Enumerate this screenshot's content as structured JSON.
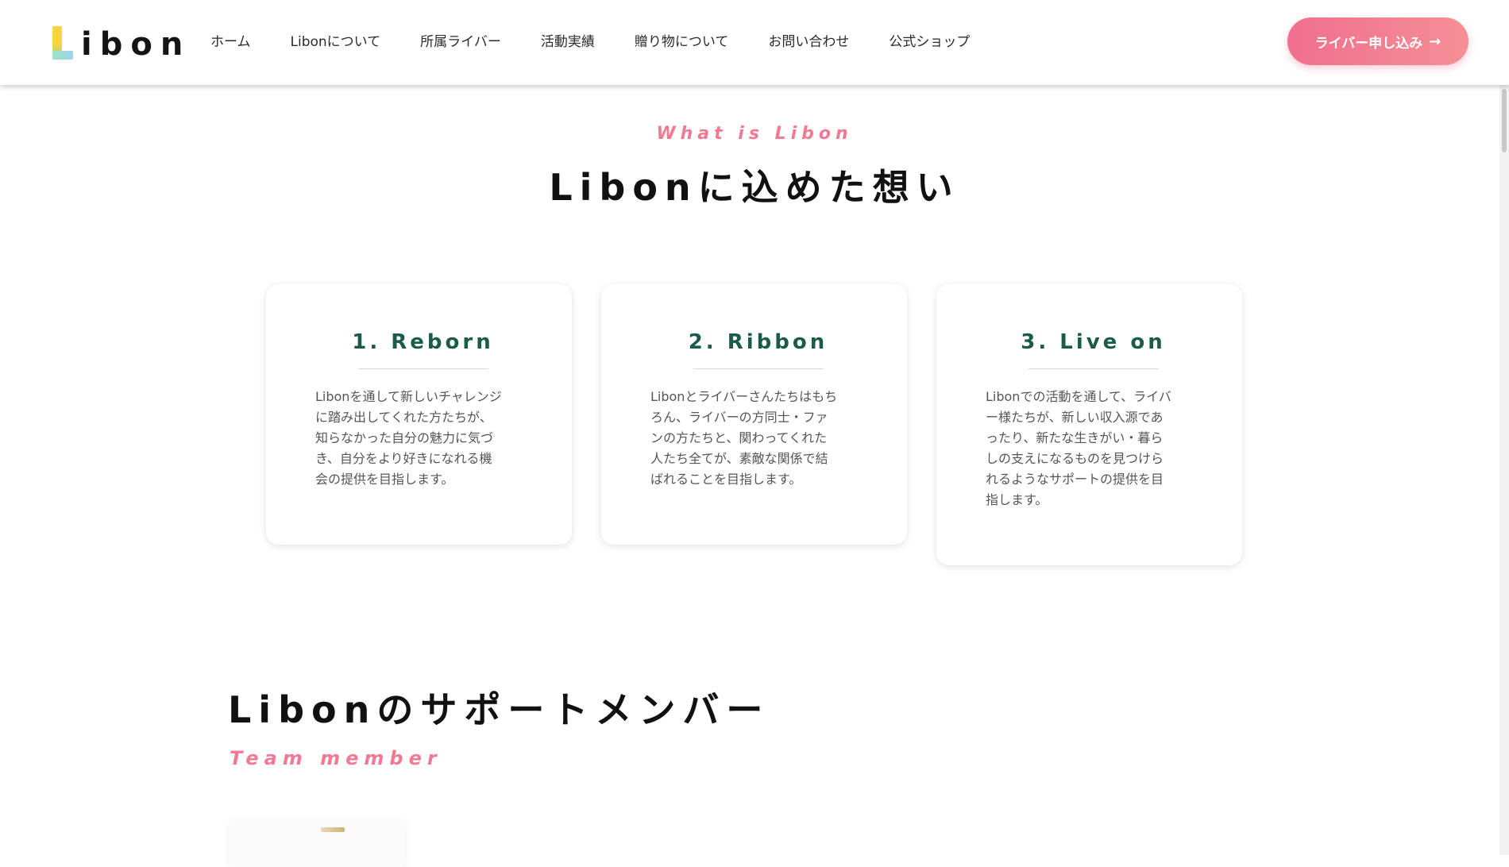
{
  "header": {
    "logo_text": "ibon",
    "nav": [
      "ホーム",
      "Libonについて",
      "所属ライバー",
      "活動実績",
      "贈り物について",
      "お問い合わせ",
      "公式ショップ"
    ],
    "cta_label": "ライバー申し込み",
    "cta_icon": "arrow-right-icon"
  },
  "about": {
    "eyebrow": "What is Libon",
    "title": "Libonに込めた想い",
    "cards": [
      {
        "title": "1. Reborn",
        "lines": [
          "Libonを通して新しいチャレンジ",
          "に踏み出してくれた方たちが、",
          "知らなかった自分の魅力に気づ",
          "き、自分をより好きになれる機",
          "会の提供を目指します。"
        ]
      },
      {
        "title": "2. Ribbon",
        "lines": [
          "Libonとライバーさんたちはもち",
          "ろん、ライバーの方同士・ファ",
          "ンの方たちと、関わってくれた",
          "人たち全てが、素敵な関係で結",
          "ばれることを目指します。"
        ]
      },
      {
        "title": "3. Live on",
        "lines": [
          "Libonでの活動を通して、ライバ",
          "ー様たちが、新しい収入源であ",
          "ったり、新たな生きがい・暮ら",
          "しの支えになるものを見つけら",
          "れるようなサポートの提供を目",
          "指します。"
        ]
      }
    ]
  },
  "members": {
    "title": "Libonのサポートメンバー",
    "eyebrow": "Team member"
  },
  "colors": {
    "accent_pink": "#f07a93",
    "card_title_green": "#1b5b4b",
    "cta_gradient_start": "#f06f8e",
    "cta_gradient_end": "#f58f95"
  }
}
